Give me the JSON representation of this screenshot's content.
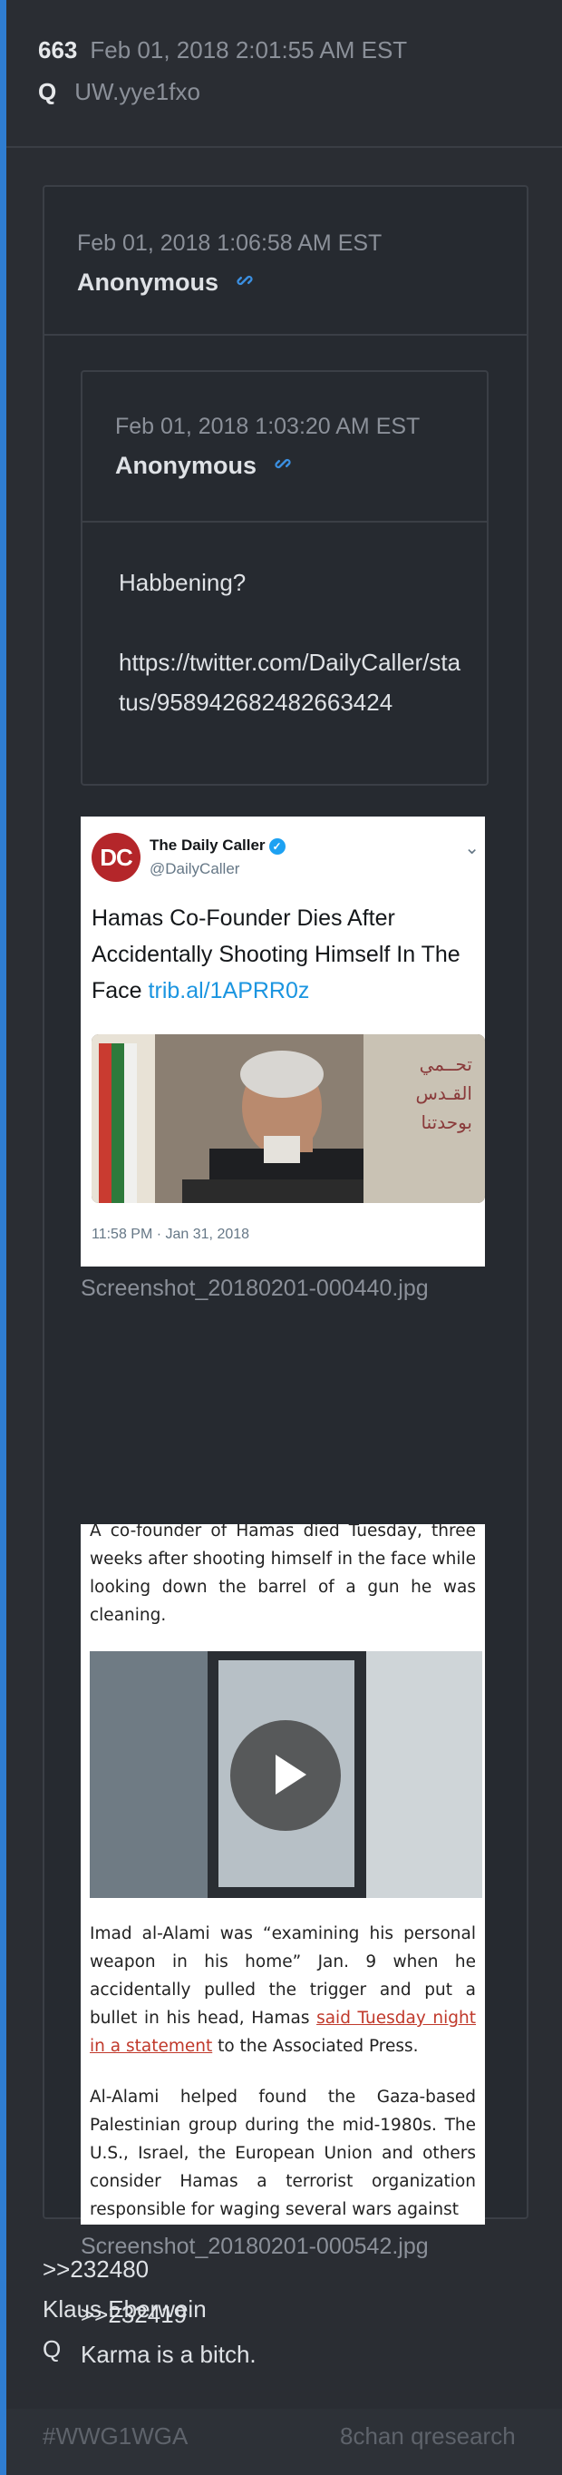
{
  "post": {
    "number": "663",
    "date": "Feb 01, 2018 2:01:55 AM EST",
    "author": "Q",
    "tripcode": "UW.yye1fxo"
  },
  "quoted_post": {
    "date": "Feb 01, 2018 1:06:58 AM EST",
    "author": "Anonymous",
    "inner_post": {
      "date": "Feb 01, 2018 1:03:20 AM EST",
      "author": "Anonymous",
      "text": "Habbening?",
      "url": "https://twitter.com/DailyCaller/status/958942682482663424"
    },
    "tweet": {
      "logo_text": "DC",
      "name": "The Daily Caller",
      "handle": "@DailyCaller",
      "text": "Hamas Co-Founder Dies After Accidentally Shooting Himself In The Face",
      "link": "trib.al/1APRR0z",
      "timestamp": "11:58 PM · Jan 31, 2018"
    },
    "image1_filename": "Screenshot_20180201-000440.jpg",
    "article": {
      "p1": "A co-founder of Hamas died Tuesday, three weeks after shooting himself in the face while looking down the barrel of a gun he was cleaning.",
      "p2_a": "Imad al-Alami was “examining his personal weapon in his home” Jan. 9 when he accidentally pulled the trigger and put a bullet in his head, Hamas ",
      "p2_link": "said Tuesday night in a statement",
      "p2_b": " to the Associated Press.",
      "p3": "Al-Alami helped found the Gaza-based Palestinian group during the mid-1980s. The U.S., Israel, the European Union and others consider Hamas a terrorist organization responsible for waging several wars against"
    },
    "image2_filename": "Screenshot_20180201-000542.jpg",
    "reply_ref": ">>232419",
    "reply_text": "Karma is a bitch."
  },
  "body": {
    "ref": ">>232480",
    "line1": "Klaus Eberwein",
    "line2": "Q"
  },
  "footer": {
    "hashtag": "#WWG1WGA",
    "source": "8chan qresearch"
  },
  "colors": {
    "accent_bar": "#2f7dd1",
    "background": "#2a2d33",
    "link_icon": "#3b8fe0"
  }
}
